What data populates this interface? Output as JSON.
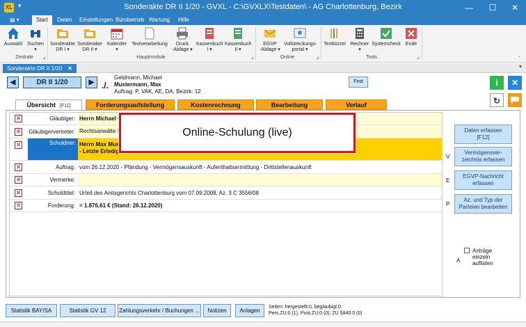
{
  "window": {
    "title": "Sonderakte DR II 1/20 - GVXL - C:\\GVXLX\\Testdaten\\ - AG Charlottenburg, Bezirk",
    "app_icon": "XL",
    "controls": {
      "minimize": "—",
      "maximize": "☐",
      "close": "✕"
    }
  },
  "ribbon_tabs": [
    "Start",
    "Daten",
    "Einstellungen",
    "Bürobetrieb",
    "Wartung",
    "Hilfe"
  ],
  "ribbon": {
    "groups": [
      {
        "label": "Zentrale"
      },
      {
        "label": "Hauptmodule"
      },
      {
        "label": "Online"
      },
      {
        "label": "Tools"
      }
    ],
    "buttons": [
      {
        "l1": "Auswahl",
        "l2": "",
        "icon": "house-icon"
      },
      {
        "l1": "Suchen",
        "l2": "▾",
        "icon": "binoculars-icon"
      },
      {
        "l1": "Sonderakte",
        "l2": "DR I ▾",
        "icon": "folder-icon"
      },
      {
        "l1": "Sonderakte",
        "l2": "DR II ▾",
        "icon": "folder-icon"
      },
      {
        "l1": "Kalender",
        "l2": "▾",
        "icon": "calendar-icon"
      },
      {
        "l1": "Textverarbeitung",
        "l2": "",
        "icon": "document-icon"
      },
      {
        "l1": "Druck",
        "l2": "-Ablage ▾",
        "icon": "printer-icon"
      },
      {
        "l1": "Kassenbuch",
        "l2": "I ▾",
        "icon": "ledger-icon"
      },
      {
        "l1": "Kassenbuch",
        "l2": "II ▾",
        "icon": "ledger-icon"
      },
      {
        "l1": "EGVP",
        "l2": "-Ablage ▾",
        "icon": "mail-icon"
      },
      {
        "l1": "Vollstreckungs-",
        "l2": "portal ▾",
        "icon": "portal-icon"
      },
      {
        "l1": "Textkürzel",
        "l2": "",
        "icon": "textkuerzel-icon"
      },
      {
        "l1": "Rechner",
        "l2": "▾",
        "icon": "calculator-icon"
      },
      {
        "l1": "Systemcheck",
        "l2": "",
        "icon": "check-icon"
      },
      {
        "l1": "Ende",
        "l2": "",
        "icon": "exit-icon"
      }
    ]
  },
  "document_tab": {
    "label": "Sonderakte DR II 1/20",
    "close": "✕"
  },
  "header": {
    "nav_prev": "◀",
    "file_number": "DR II 1/20",
    "nav_next": "▶",
    "separator": "./.",
    "line1": "Geldmann, Michael",
    "line2": "Mustermann, Max",
    "line3": "Auftrag: P, VAK, AE, DA, Bezirk: 12",
    "frist": "Frist"
  },
  "side_icons": {
    "info": "i",
    "close": "✕",
    "refresh": "↻",
    "chat": "💬"
  },
  "tabs": [
    {
      "label": "Übersicht",
      "key": "[F11]"
    },
    {
      "label": "Forderungsaufstellung"
    },
    {
      "label": "Kostenrechnung"
    },
    {
      "label": "Bearbeitung"
    },
    {
      "label": "Verlauf"
    }
  ],
  "rows": [
    {
      "label": "Gläubiger:",
      "value": "Herrn Michael G"
    },
    {
      "label": "Gläubigervertreter:",
      "value": "Rechtsanwälte Sp"
    },
    {
      "label": "Schuldner:",
      "value1": "Herrn Max Must",
      "value2": "- Letzte Erledig"
    },
    {
      "label": "Auftrag:",
      "value": "vom 26.12.2020 - Pfändung - Vermögensauskunft - Aufenthaltsermittlung - Drittstellenauskunft"
    },
    {
      "label": "Vermerke:",
      "value": ""
    },
    {
      "label": "Schuldtitel:",
      "value": "Urteil des Amtsgerichts Charlottenburg vom 07.09.2008, Az. 3 C 3556/08"
    },
    {
      "label": "Forderung:",
      "value": "= 1.876,61 € (Stand: 26.12.2020)"
    }
  ],
  "row_checkbox": "✕",
  "right_buttons": [
    {
      "l1": "Daten erfassen",
      "l2": "[F12]",
      "letter": ""
    },
    {
      "l1": "Vermögensver-",
      "l2": "zeichnis erfassen",
      "letter": "V"
    },
    {
      "l1": "EGVP-Nachricht",
      "l2": "erfassen",
      "letter": "E"
    },
    {
      "l1": "Az. und Typ der",
      "l2": "Parteien bearbeiten",
      "letter": "P"
    }
  ],
  "antraege": {
    "letter": "A",
    "l1": "Anträge",
    "l2": "einzeln",
    "l3": "auflisten"
  },
  "overlay": "Online-Schulung (live)",
  "bottom_buttons": [
    "Statistik BAY/SA",
    "Statistik GV 12",
    "Zahlungsverkehr / Buchungen ...",
    "Notizen",
    "Anlagen"
  ],
  "bottom_info": {
    "line1": "Seiten: hergestellt:0, beglaubigt:0",
    "line2": "Pers.ZU:0 (1), Post.ZU:0 (0), ZU §840:0 (0)"
  },
  "colors": {
    "titlebar": "#2e7fc4",
    "highlight_blue": "#1a73c6",
    "highlight_yellow": "#ffd000",
    "tab_orange": "#f9a31a",
    "info_green": "#2fb84b",
    "close_blue": "#1e88e5",
    "chat_orange": "#f39c12",
    "overlay_border": "#e0111b"
  }
}
